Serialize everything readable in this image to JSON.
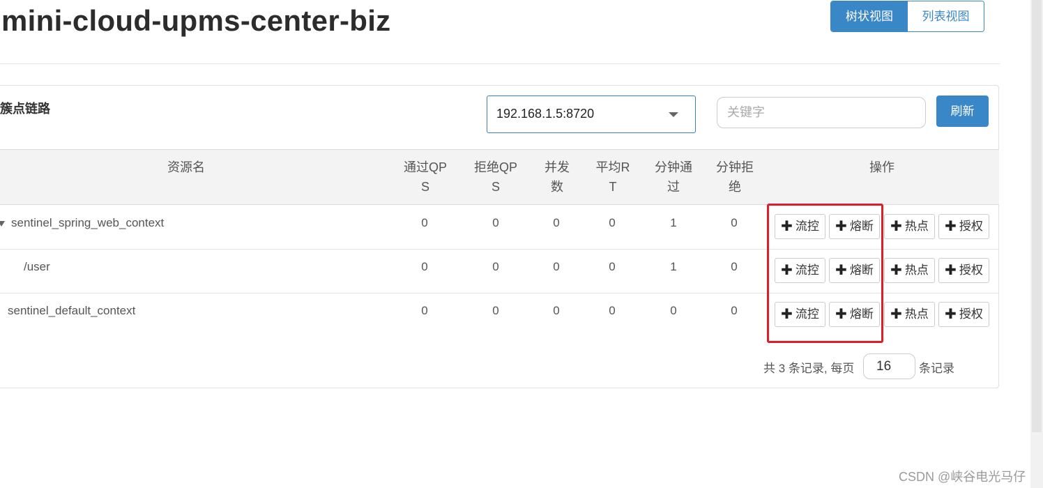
{
  "header": {
    "app_title": "mini-cloud-upms-center-biz",
    "view_toggle": {
      "tree_label": "树状视图",
      "list_label": "列表视图",
      "active": "tree"
    }
  },
  "panel": {
    "title": "簇点链路",
    "machine_select_value": "192.168.1.5:8720",
    "keyword_placeholder": "关键字",
    "keyword_value": "",
    "refresh_label": "刷新"
  },
  "table": {
    "columns": {
      "resource": "资源名",
      "pass_qps_1": "通过QP",
      "pass_qps_2": "S",
      "block_qps_1": "拒绝QP",
      "block_qps_2": "S",
      "concurrency_1": "并发",
      "concurrency_2": "数",
      "avg_rt_1": "平均R",
      "avg_rt_2": "T",
      "minute_pass_1": "分钟通",
      "minute_pass_2": "过",
      "minute_block_1": "分钟拒",
      "minute_block_2": "绝",
      "actions": "操作"
    },
    "rows": [
      {
        "name": "sentinel_spring_web_context",
        "pass_qps": "0",
        "block_qps": "0",
        "concurrency": "0",
        "avg_rt": "0",
        "minute_pass": "1",
        "minute_block": "0",
        "expanded": true
      },
      {
        "name": "/user",
        "pass_qps": "0",
        "block_qps": "0",
        "concurrency": "0",
        "avg_rt": "0",
        "minute_pass": "1",
        "minute_block": "0"
      },
      {
        "name": "sentinel_default_context",
        "pass_qps": "0",
        "block_qps": "0",
        "concurrency": "0",
        "avg_rt": "0",
        "minute_pass": "0",
        "minute_block": "0"
      }
    ],
    "action_labels": {
      "flow": "流控",
      "degrade": "熔断",
      "hotspot": "热点",
      "authority": "授权"
    }
  },
  "pagination": {
    "prefix": "共 3 条记录, 每页",
    "page_size": "16",
    "suffix": "条记录"
  },
  "watermark": "CSDN @峡谷电光马仔",
  "colors": {
    "primary": "#3a87c8",
    "highlight": "#e01c24"
  },
  "icons": [
    "plus-icon",
    "caret-down-icon",
    "tree-expanded-icon"
  ]
}
